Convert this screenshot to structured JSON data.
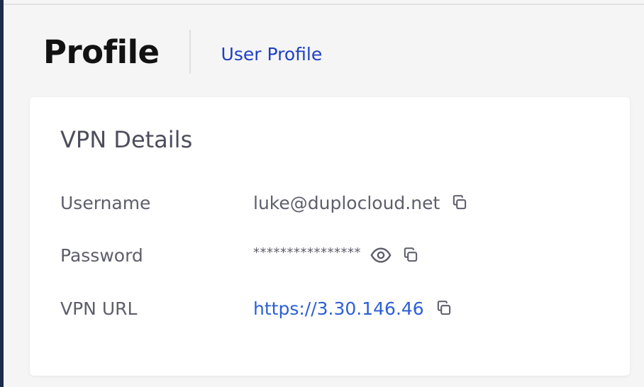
{
  "header": {
    "title": "Profile",
    "breadcrumb": "User Profile"
  },
  "vpn_details": {
    "title": "VPN Details",
    "rows": [
      {
        "label": "Username",
        "value": "luke@duplocloud.net",
        "actions": [
          "copy-icon"
        ]
      },
      {
        "label": "Password",
        "value": "****************",
        "actions": [
          "eye-icon",
          "copy-icon"
        ]
      },
      {
        "label": "VPN URL",
        "value": "https://3.30.146.46",
        "actions": [
          "copy-icon"
        ]
      }
    ]
  },
  "colors": {
    "link": "#1f3fc4",
    "url_link": "#2c5fd6",
    "sidebar_accent": "#1d2a4a",
    "text_muted": "#5e5e6c",
    "heading": "#121212"
  }
}
